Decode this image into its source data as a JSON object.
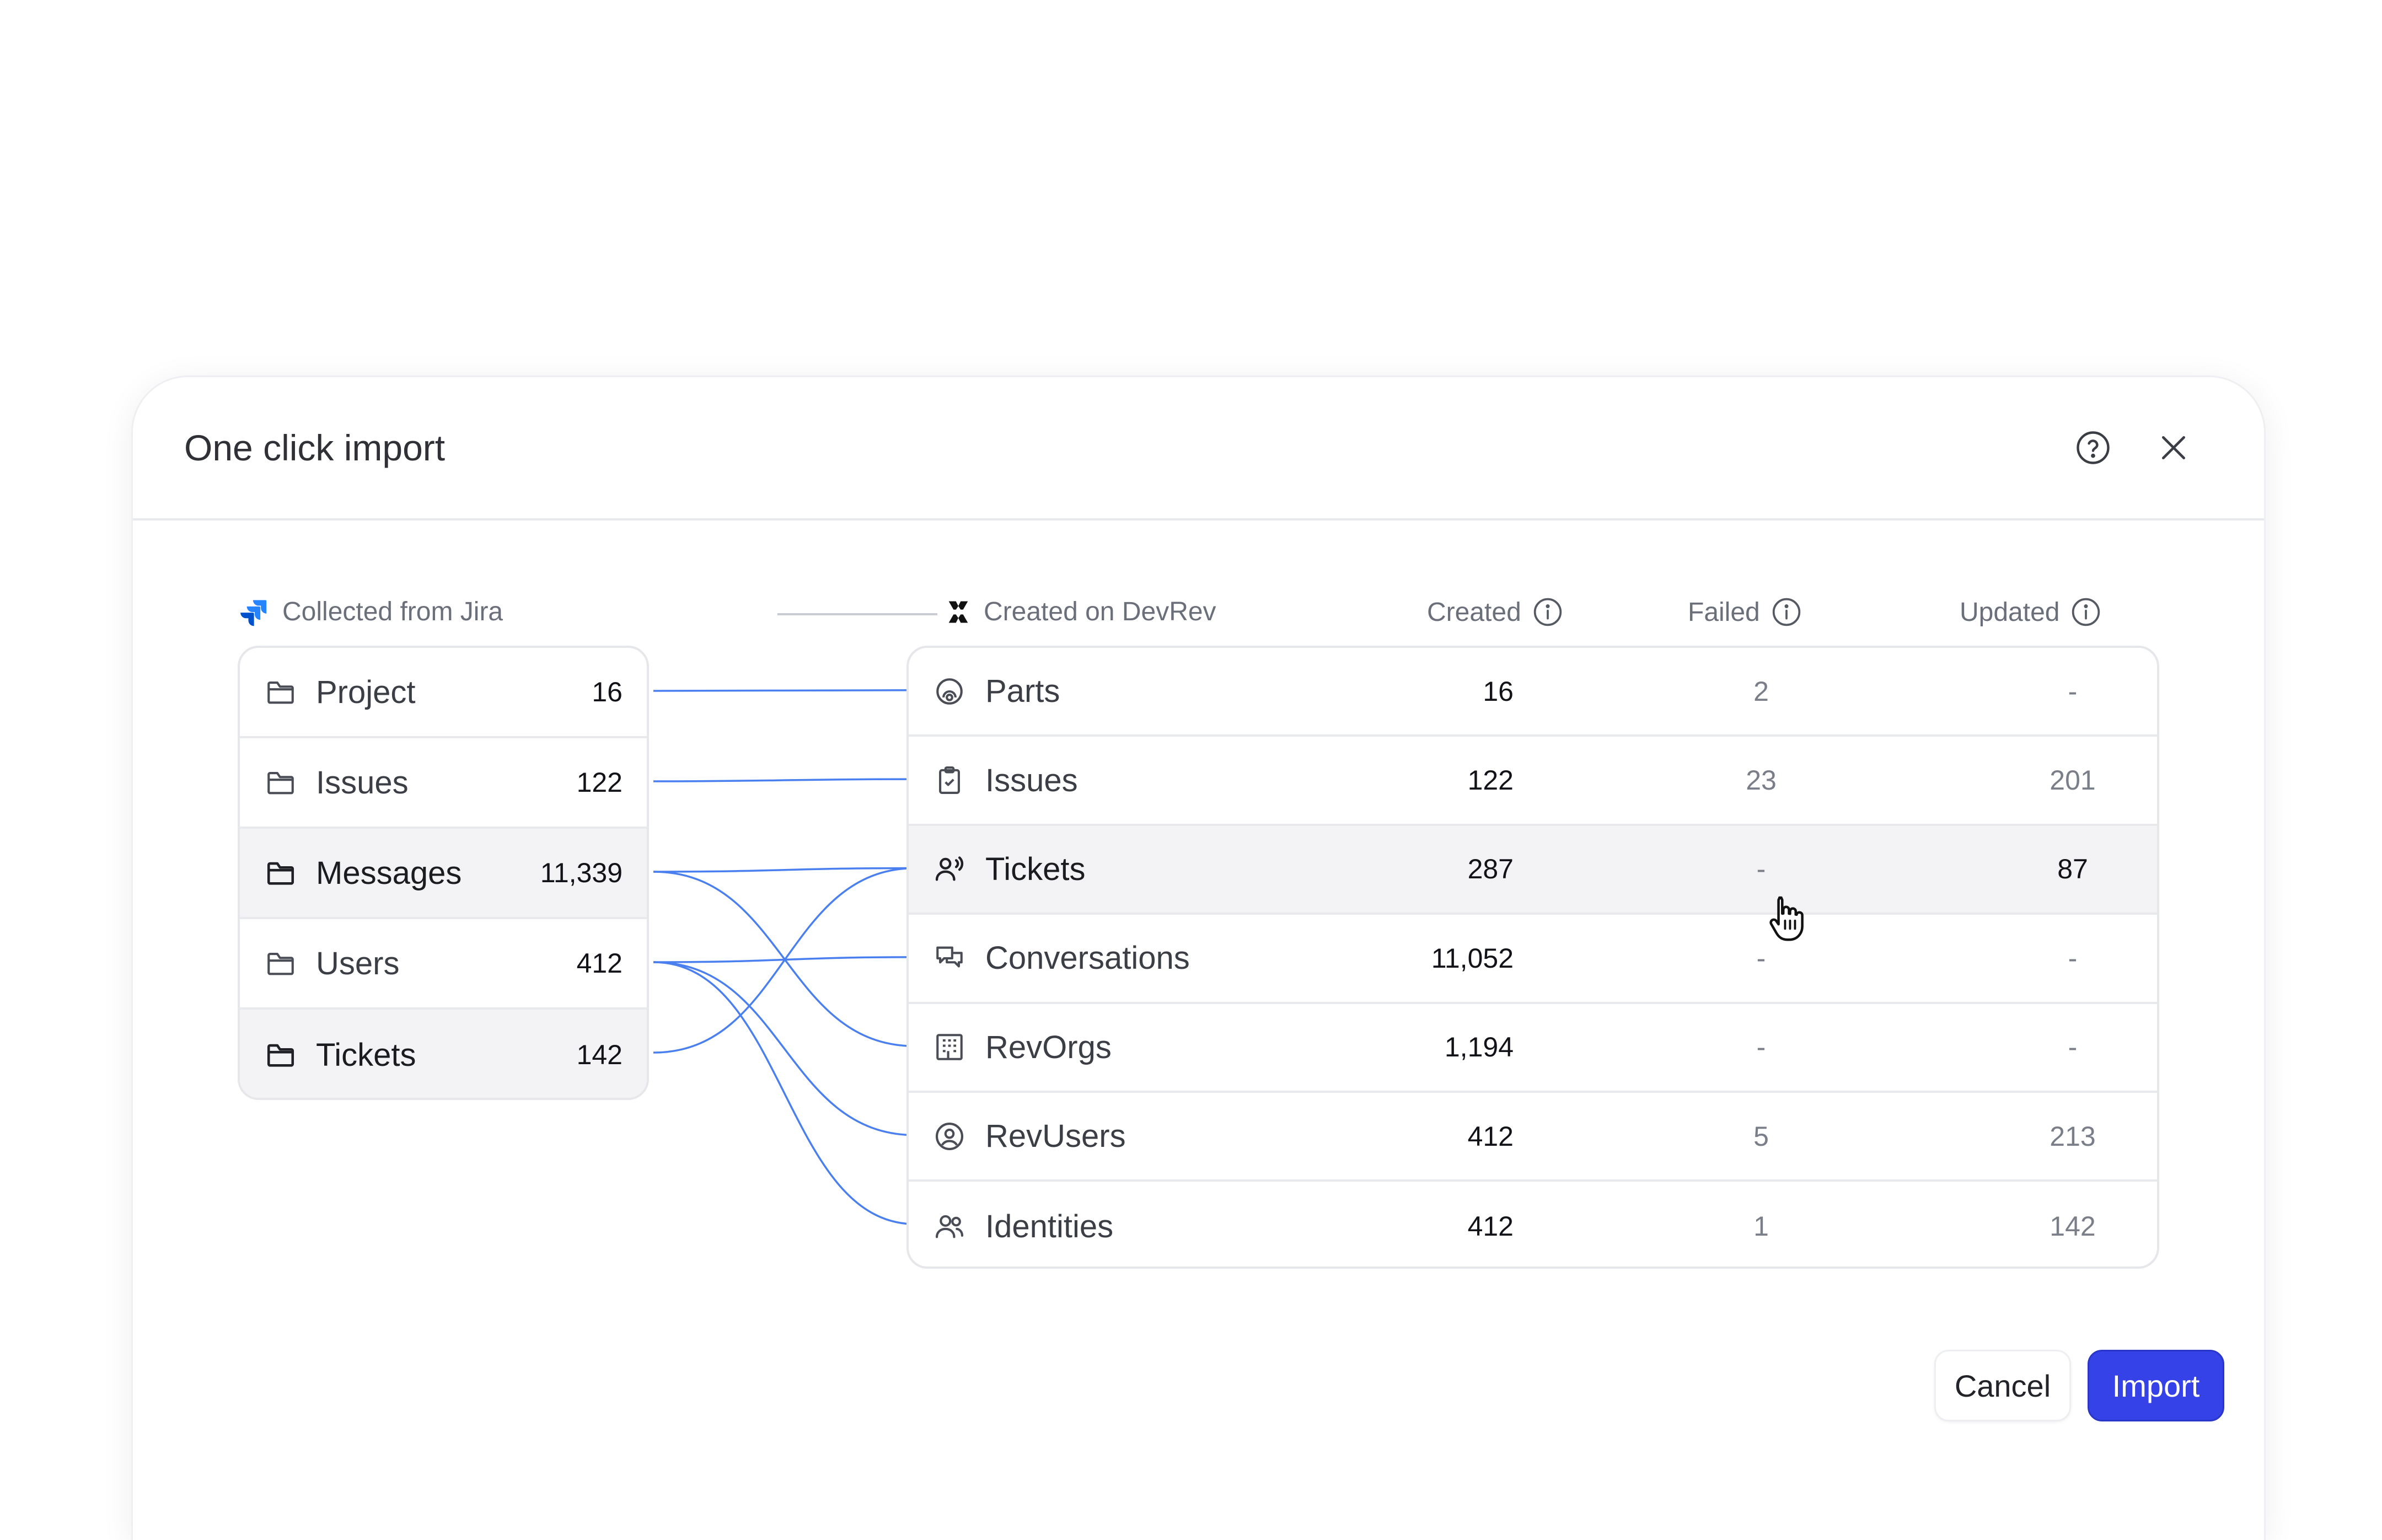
{
  "dialog": {
    "title": "One click import",
    "help_icon": "help-circle-icon",
    "close_icon": "close-icon"
  },
  "source": {
    "heading": "Collected from Jira",
    "logo": "jira-logo-icon",
    "rows": [
      {
        "label": "Project",
        "count": "16",
        "icon": "folder-icon"
      },
      {
        "label": "Issues",
        "count": "122",
        "icon": "folder-icon"
      },
      {
        "label": "Messages",
        "count": "11,339",
        "icon": "folder-icon"
      },
      {
        "label": "Users",
        "count": "412",
        "icon": "folder-icon"
      },
      {
        "label": "Tickets",
        "count": "142",
        "icon": "folder-icon"
      }
    ]
  },
  "destination": {
    "heading": "Created on DevRev",
    "logo": "devrev-logo-icon",
    "columns": {
      "created": "Created",
      "failed": "Failed",
      "updated": "Updated"
    },
    "rows": [
      {
        "label": "Parts",
        "icon": "parts-icon",
        "created": "16",
        "failed": "2",
        "updated": "-"
      },
      {
        "label": "Issues",
        "icon": "clipboard-check-icon",
        "created": "122",
        "failed": "23",
        "updated": "201"
      },
      {
        "label": "Tickets",
        "icon": "user-voice-icon",
        "created": "287",
        "failed": "-",
        "updated": "87"
      },
      {
        "label": "Conversations",
        "icon": "chat-bubbles-icon",
        "created": "11,052",
        "failed": "-",
        "updated": "-"
      },
      {
        "label": "RevOrgs",
        "icon": "building-icon",
        "created": "1,194",
        "failed": "-",
        "updated": "-"
      },
      {
        "label": "RevUsers",
        "icon": "user-circle-icon",
        "created": "412",
        "failed": "5",
        "updated": "213"
      },
      {
        "label": "Identities",
        "icon": "users-icon",
        "created": "412",
        "failed": "1",
        "updated": "142"
      }
    ]
  },
  "mappings": [
    {
      "from": "Project",
      "to": "Parts"
    },
    {
      "from": "Issues",
      "to": "Issues"
    },
    {
      "from": "Messages",
      "to": "Tickets"
    },
    {
      "from": "Messages",
      "to": "RevOrgs"
    },
    {
      "from": "Users",
      "to": "Conversations"
    },
    {
      "from": "Users",
      "to": "RevUsers"
    },
    {
      "from": "Users",
      "to": "Identities"
    },
    {
      "from": "Tickets",
      "to": "Tickets"
    }
  ],
  "actions": {
    "cancel": "Cancel",
    "import": "Import"
  },
  "colors": {
    "accent": "#3442e8",
    "link": "#4a7ff0"
  }
}
